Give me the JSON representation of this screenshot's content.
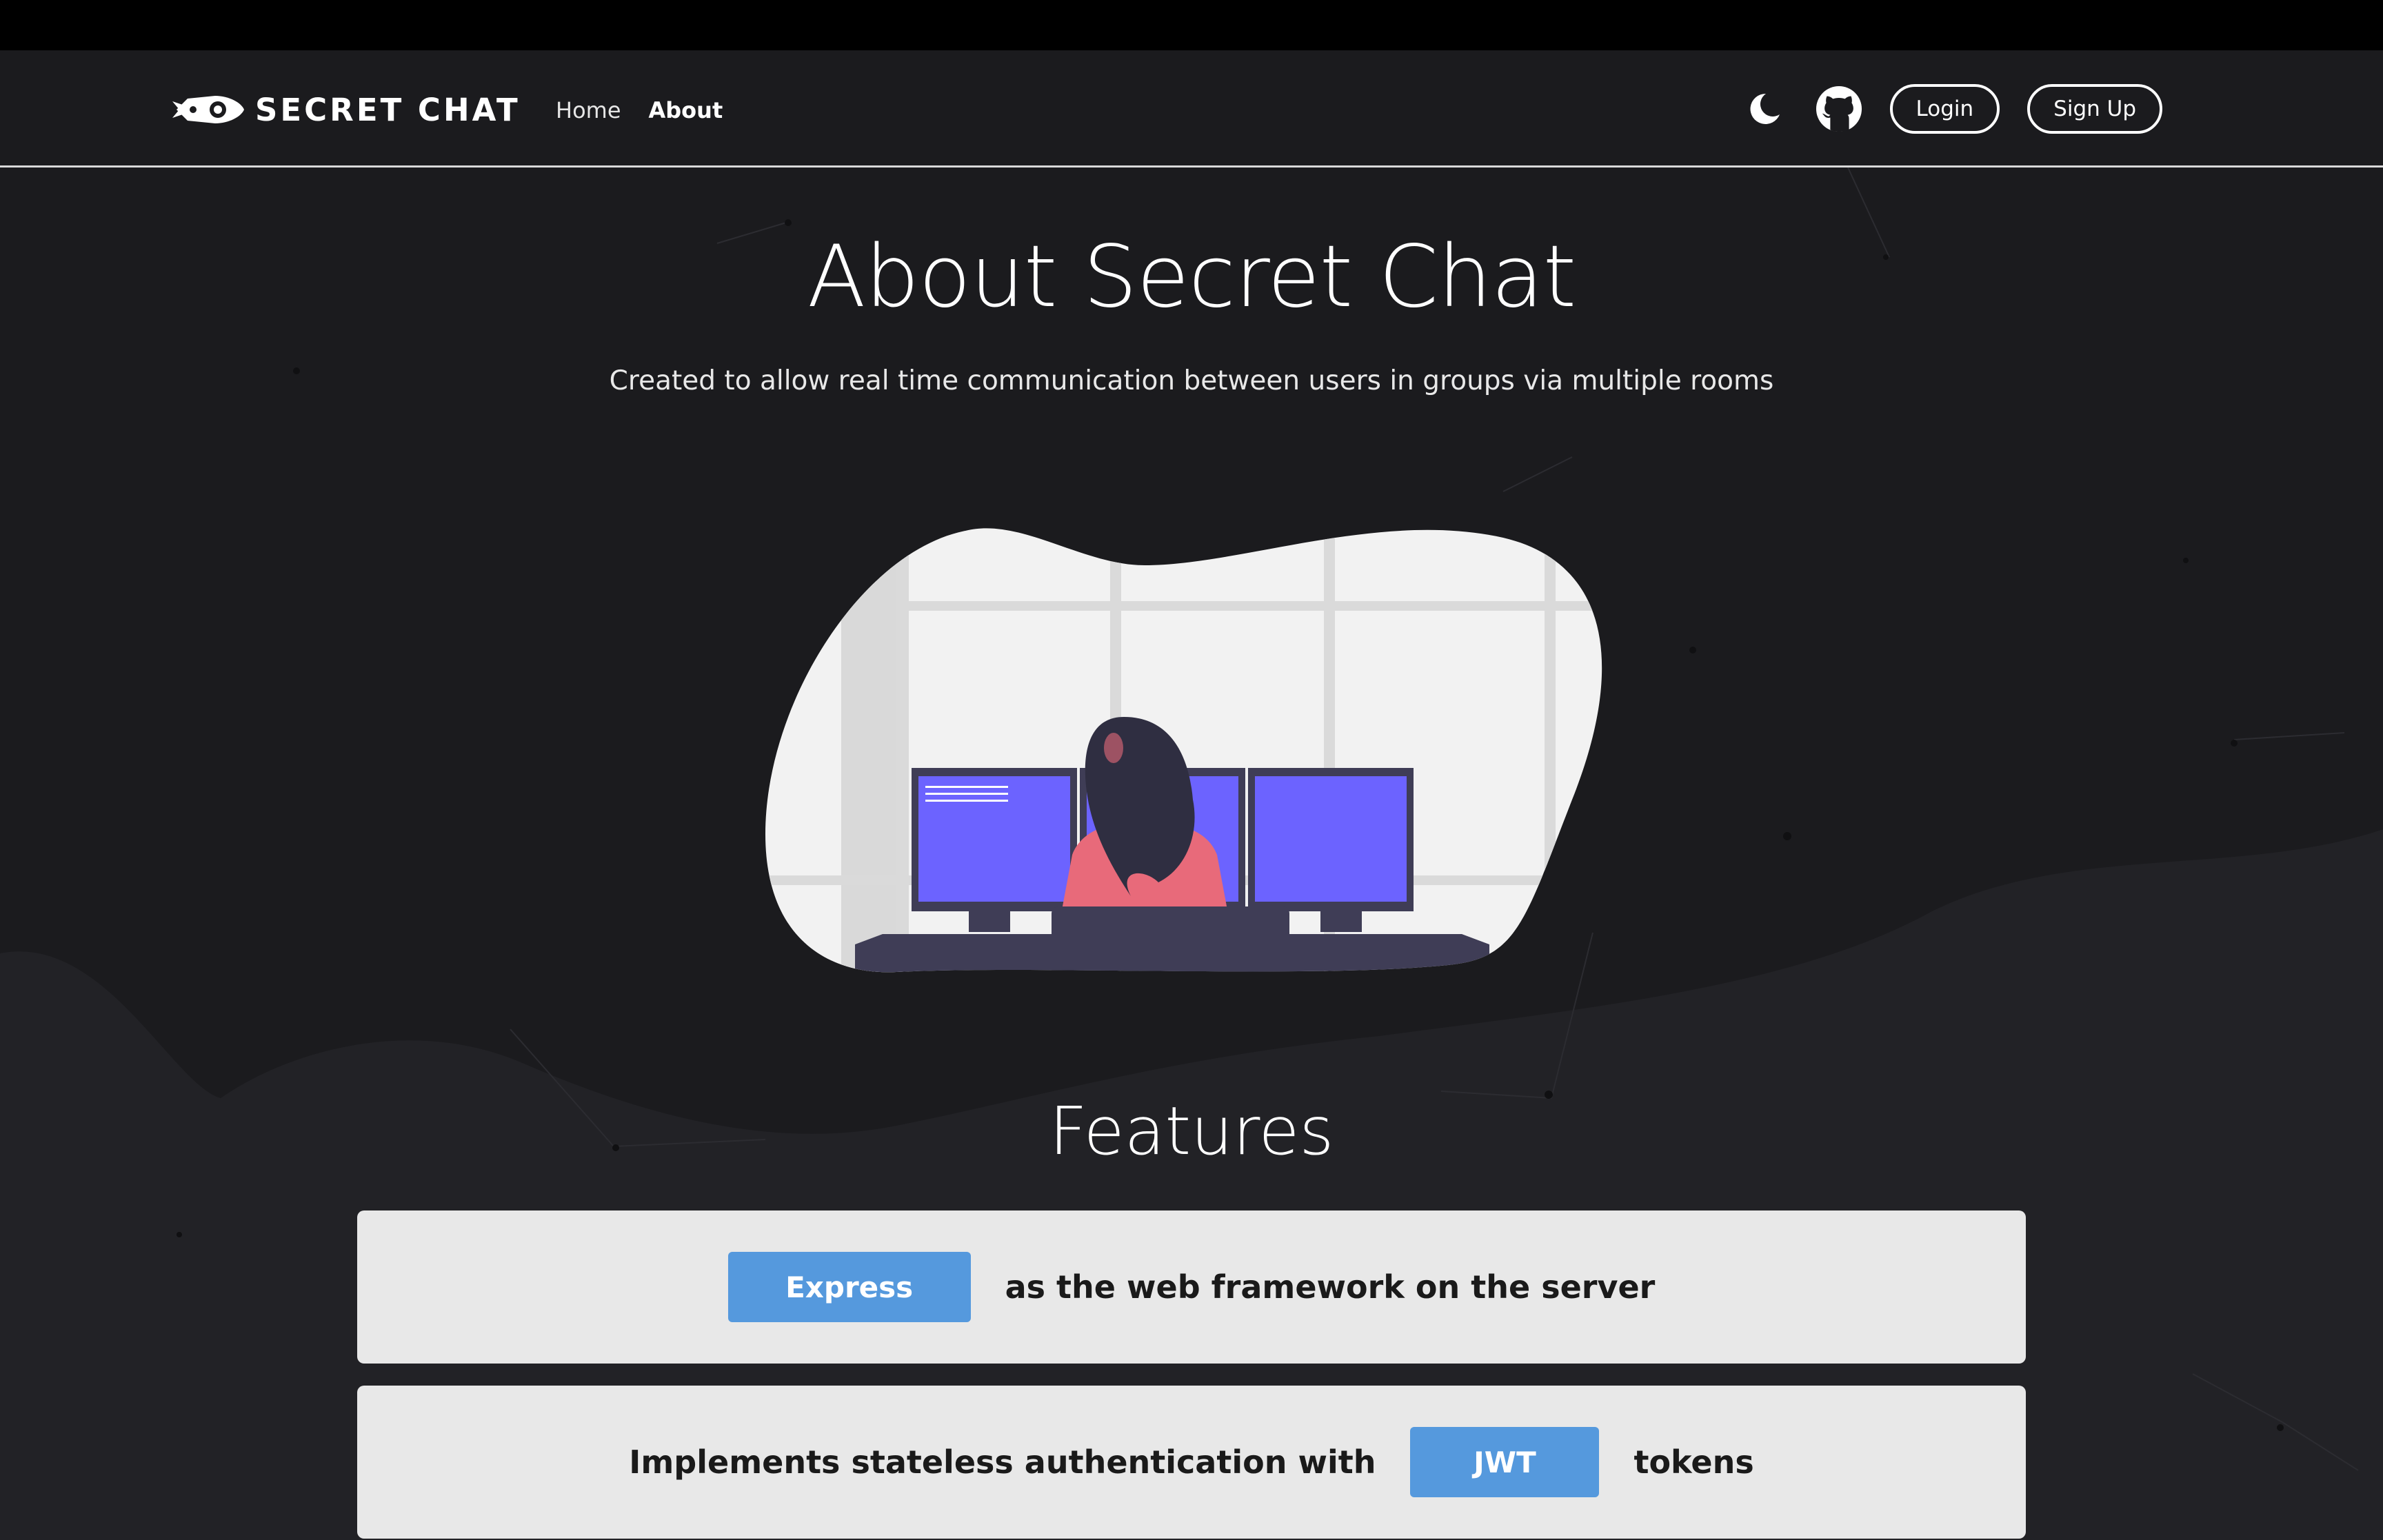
{
  "navbar": {
    "brand_text": "SECRET CHAT",
    "links": [
      {
        "label": "Home",
        "active": false
      },
      {
        "label": "About",
        "active": true
      }
    ],
    "theme_toggle_icon": "moon-icon",
    "github_icon": "github-icon",
    "login_label": "Login",
    "signup_label": "Sign Up"
  },
  "hero": {
    "title": "About Secret Chat",
    "subtitle": "Created to allow real time communication between users in groups via multiple rooms"
  },
  "features": {
    "title": "Features",
    "items": [
      {
        "tag": "Express",
        "text_before": "",
        "text_after": "as the web framework on the server"
      },
      {
        "tag": "JWT",
        "text_before": "Implements stateless authentication with",
        "text_after": "tokens"
      }
    ]
  },
  "colors": {
    "background": "#1b1b1e",
    "card": "#e8e8e8",
    "tag": "#5599dd",
    "screen": "#6c63ff",
    "shirt": "#e86a7a"
  }
}
